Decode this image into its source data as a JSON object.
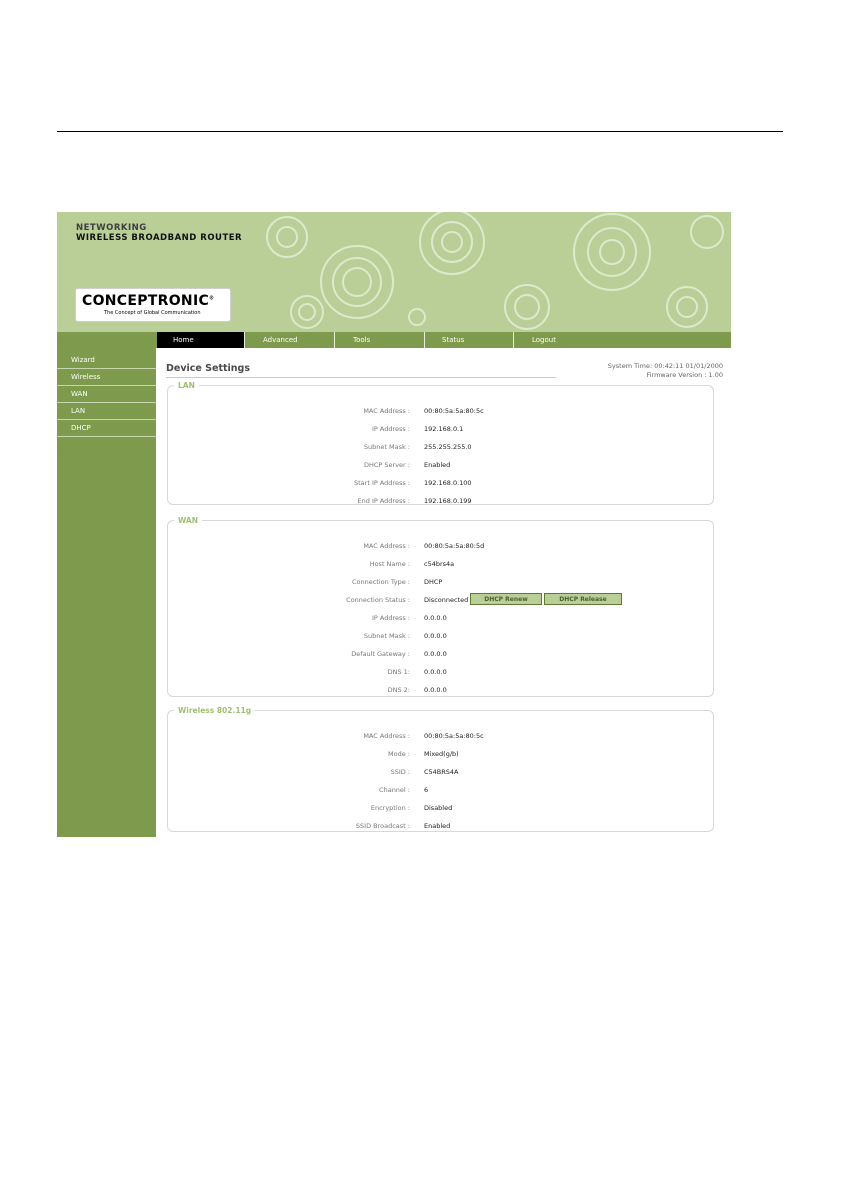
{
  "header": {
    "line1": "NETWORKING",
    "line2": "WIRELESS BROADBAND ROUTER",
    "logo_name": "CONCEPTRONIC",
    "logo_mark": "®",
    "logo_tagline": "The Concept of Global Communication"
  },
  "nav": [
    {
      "label": "Home"
    },
    {
      "label": "Advanced"
    },
    {
      "label": "Tools"
    },
    {
      "label": "Status"
    },
    {
      "label": "Logout"
    }
  ],
  "sidebar": [
    {
      "label": "Wizard"
    },
    {
      "label": "Wireless"
    },
    {
      "label": "WAN"
    },
    {
      "label": "LAN"
    },
    {
      "label": "DHCP"
    }
  ],
  "page": {
    "title": "Device Settings",
    "system_time": "System Time: 00:42:11 01/01/2000",
    "firmware": "Firmware Version : 1.00"
  },
  "lan": {
    "legend": "LAN",
    "rows": [
      {
        "label": "MAC Address :",
        "value": "00:80:5a:5a:80:5c"
      },
      {
        "label": "IP Address :",
        "value": "192.168.0.1"
      },
      {
        "label": "Subnet Mask :",
        "value": "255.255.255.0"
      },
      {
        "label": "DHCP Server :",
        "value": "Enabled"
      },
      {
        "label": "Start IP Address :",
        "value": "192.168.0.100"
      },
      {
        "label": "End IP Address :",
        "value": "192.168.0.199"
      }
    ]
  },
  "wan": {
    "legend": "WAN",
    "rows": [
      {
        "label": "MAC Address :",
        "value": "00:80:5a:5a:80:5d"
      },
      {
        "label": "Host Name :",
        "value": "c54brs4a"
      },
      {
        "label": "Connection Type :",
        "value": "DHCP"
      },
      {
        "label": "Connection Status :",
        "value": "Disconnected"
      },
      {
        "label": "IP Address :",
        "value": "0.0.0.0"
      },
      {
        "label": "Subnet Mask :",
        "value": "0.0.0.0"
      },
      {
        "label": "Default Gateway :",
        "value": "0.0.0.0"
      },
      {
        "label": "DNS 1:",
        "value": "0.0.0.0"
      },
      {
        "label": "DNS 2:",
        "value": "0.0.0.0"
      }
    ],
    "renew_label": "DHCP Renew",
    "release_label": "DHCP Release"
  },
  "wireless": {
    "legend": "Wireless 802.11g",
    "rows": [
      {
        "label": "MAC Address :",
        "value": "00:80:5a:5a:80:5c"
      },
      {
        "label": "Mode :",
        "value": "Mixed(g/b)"
      },
      {
        "label": "SSID :",
        "value": "C54BRS4A"
      },
      {
        "label": "Channel :",
        "value": "6"
      },
      {
        "label": "Encryption :",
        "value": "Disabled"
      },
      {
        "label": "SSID Broadcast :",
        "value": "Enabled"
      }
    ]
  },
  "colors": {
    "accent": "#7e9a4d",
    "banner": "#b9cf97",
    "legend": "#9fbf74"
  }
}
